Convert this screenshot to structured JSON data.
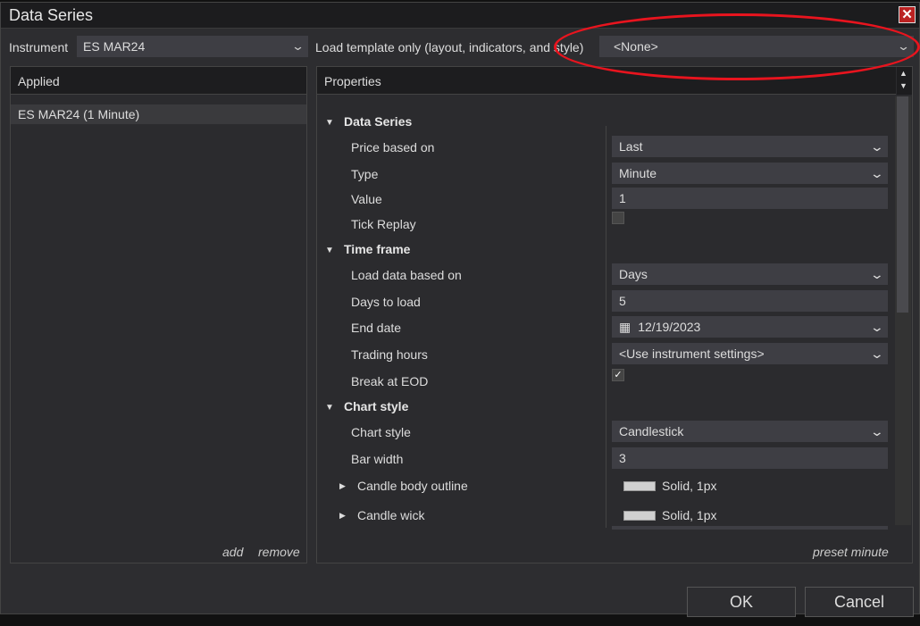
{
  "window": {
    "title": "Data Series"
  },
  "toolbar": {
    "instrument_label": "Instrument",
    "instrument_value": "ES MAR24",
    "template_label": "Load template only (layout, indicators, and style)",
    "template_value": "<None>"
  },
  "applied": {
    "header": "Applied",
    "items": [
      "ES MAR24 (1 Minute)"
    ],
    "add": "add",
    "remove": "remove"
  },
  "properties": {
    "header": "Properties",
    "preset": "preset minute",
    "sections": [
      {
        "title": "Data Series",
        "rows": [
          {
            "label": "Price based on",
            "kind": "dropdown",
            "value": "Last"
          },
          {
            "label": "Type",
            "kind": "dropdown",
            "value": "Minute"
          },
          {
            "label": "Value",
            "kind": "text",
            "value": "1"
          },
          {
            "label": "Tick Replay",
            "kind": "checkbox",
            "checked": false
          }
        ]
      },
      {
        "title": "Time frame",
        "rows": [
          {
            "label": "Load data based on",
            "kind": "dropdown",
            "value": "Days"
          },
          {
            "label": "Days to load",
            "kind": "text",
            "value": "5"
          },
          {
            "label": "End date",
            "kind": "date",
            "value": "12/19/2023"
          },
          {
            "label": "Trading hours",
            "kind": "dropdown",
            "value": "<Use instrument settings>"
          },
          {
            "label": "Break at EOD",
            "kind": "checkbox",
            "checked": true
          }
        ]
      },
      {
        "title": "Chart style",
        "rows": [
          {
            "label": "Chart style",
            "kind": "dropdown",
            "value": "Candlestick"
          },
          {
            "label": "Bar width",
            "kind": "text",
            "value": "3"
          },
          {
            "label": "Candle body outline",
            "kind": "stroke",
            "value": "Solid, 1px"
          },
          {
            "label": "Candle wick",
            "kind": "stroke",
            "value": "Solid, 1px"
          }
        ]
      }
    ]
  },
  "buttons": {
    "ok": "OK",
    "cancel": "Cancel"
  },
  "colors": {
    "background": "#2d2d30",
    "annotation": "#e8141e",
    "close": "#bb2222"
  }
}
